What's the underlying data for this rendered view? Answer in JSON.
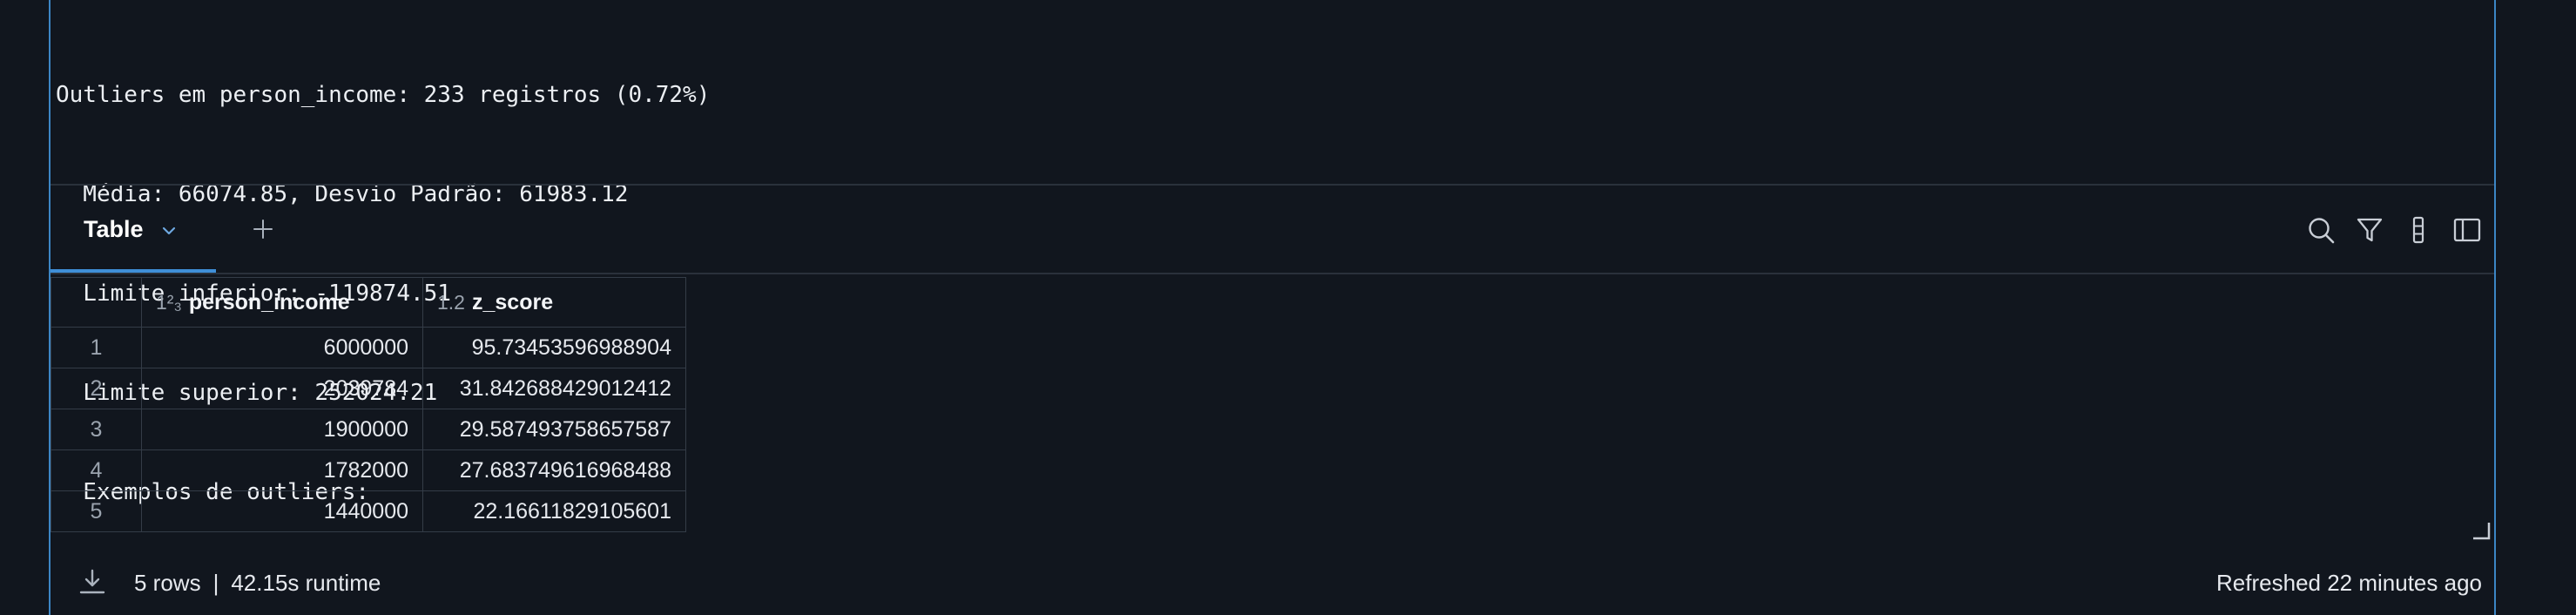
{
  "output": {
    "lines": [
      "Outliers em person_income: 233 registros (0.72%)",
      "  Média: 66074.85, Desvio Padrão: 61983.12",
      "  Limite inferior: -119874.51",
      "  Limite superior: 252024.21",
      "  Exemplos de outliers:"
    ]
  },
  "toolbar": {
    "active_tab": "Table",
    "icons": [
      "search-icon",
      "filter-icon",
      "column-settings-icon",
      "sidebar-panel-icon"
    ]
  },
  "table": {
    "columns": [
      {
        "type_badge": "1²₃",
        "label": "person_income"
      },
      {
        "type_badge": "1.2",
        "label": "z_score"
      }
    ],
    "rows": [
      {
        "idx": "1",
        "person_income": "6000000",
        "z_score": "95.73453596988904"
      },
      {
        "idx": "2",
        "person_income": "2039784",
        "z_score": "31.842688429012412"
      },
      {
        "idx": "3",
        "person_income": "1900000",
        "z_score": "29.587493758657587"
      },
      {
        "idx": "4",
        "person_income": "1782000",
        "z_score": "27.683749616968488"
      },
      {
        "idx": "5",
        "person_income": "1440000",
        "z_score": "22.16611829105601"
      }
    ]
  },
  "footer": {
    "rows_text": "5 rows",
    "separator": "|",
    "runtime_text": "42.15s runtime",
    "refreshed_text": "Refreshed 22 minutes ago"
  },
  "colors": {
    "background": "#11161e",
    "accent": "#3f8fd8",
    "cell_border": "#3c86c5"
  }
}
